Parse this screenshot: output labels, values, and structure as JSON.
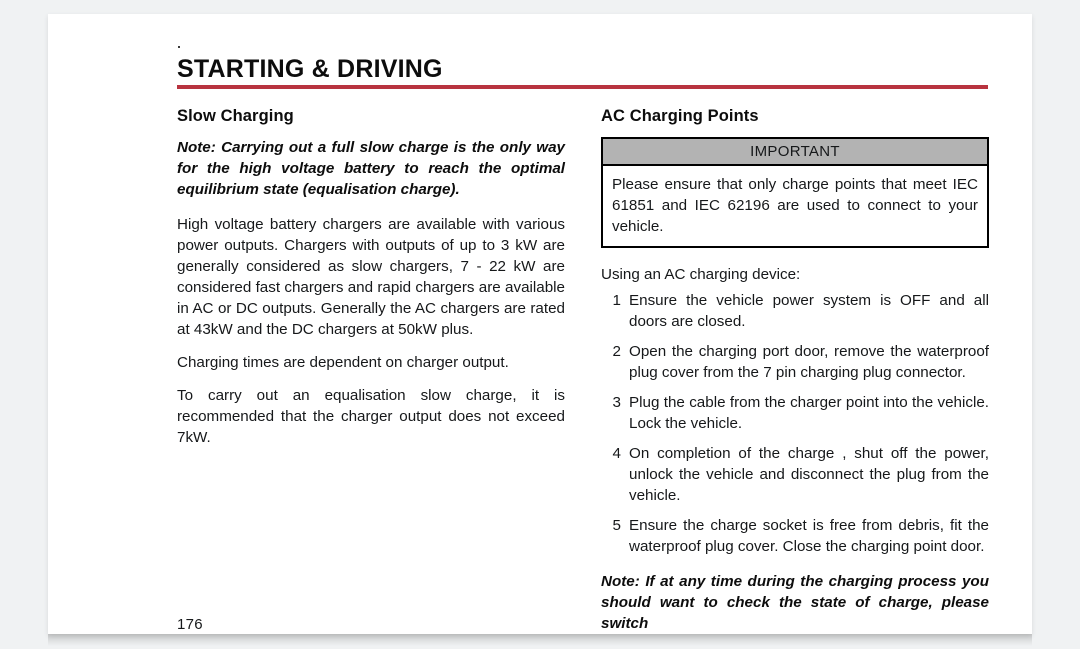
{
  "page": {
    "chapter_title": "STARTING & DRIVING",
    "page_number": "176",
    "rule_color": "#b8333f",
    "sheet_background": "#ffffff",
    "canvas_background": "#f0f2f3"
  },
  "left_column": {
    "heading": "Slow Charging",
    "note": "Note: Carrying out a full slow charge is the only way for the high voltage battery to reach the optimal equilibrium state (equalisation charge).",
    "paragraphs": [
      "High voltage battery chargers are available with various power outputs.  Chargers with outputs of up to 3 kW are generally considered as slow chargers, 7 - 22 kW are considered fast chargers and rapid chargers are available in AC or DC outputs.  Generally the AC chargers are rated at 43kW and the DC chargers at 50kW plus.",
      "Charging times are dependent on charger output.",
      "To carry out an equalisation slow charge, it is recommended that the charger output does not exceed 7kW."
    ]
  },
  "right_column": {
    "heading": "AC Charging Points",
    "callout": {
      "header_label": "IMPORTANT",
      "header_background": "#b3b3b3",
      "border_color": "#000000",
      "body": "Please ensure that only charge points that meet IEC 61851 and IEC 62196 are used to connect to your vehicle."
    },
    "list_intro": "Using an AC charging device:",
    "steps": [
      {
        "number": "1",
        "text": "Ensure the vehicle power system is OFF and all doors are closed."
      },
      {
        "number": "2",
        "text": "Open the charging port door, remove the waterproof plug cover from the 7 pin charging plug connector."
      },
      {
        "number": "3",
        "text": "Plug the cable from the charger point into the vehicle. Lock the vehicle."
      },
      {
        "number": "4",
        "text": "On completion of the charge ,  shut off the power, unlock the vehicle and disconnect the plug from the vehicle."
      },
      {
        "number": "5",
        "text": "Ensure the charge socket is free from debris, fit the waterproof plug cover. Close the charging point door."
      }
    ],
    "trailing_note": "Note: If at any time during the charging process you should want to check the state of charge, please switch"
  }
}
